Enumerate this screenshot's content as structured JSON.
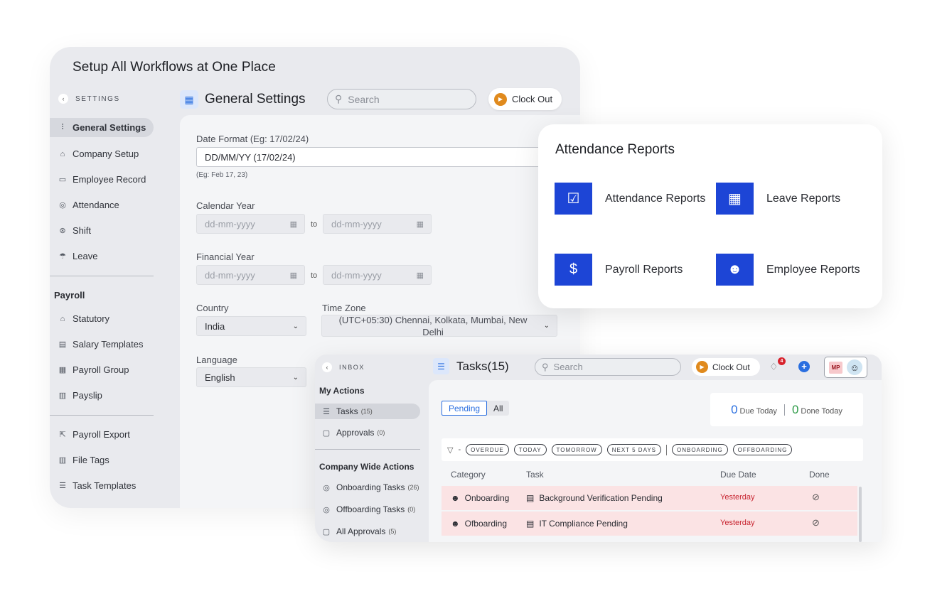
{
  "headline": "Setup All Workflows at One Place",
  "settings": {
    "section_label": "SETTINGS",
    "items": [
      {
        "label": "General Settings",
        "icon": "sliders-icon",
        "glyph": "⫶"
      },
      {
        "label": "Company Setup",
        "icon": "building-icon",
        "glyph": "⌂"
      },
      {
        "label": "Employee Record",
        "icon": "id-card-icon",
        "glyph": "▭"
      },
      {
        "label": "Attendance",
        "icon": "fingerprint-icon",
        "glyph": "◎"
      },
      {
        "label": "Shift",
        "icon": "shift-icon",
        "glyph": "⊛"
      },
      {
        "label": "Leave",
        "icon": "umbrella-icon",
        "glyph": "☂"
      }
    ],
    "payroll_section": "Payroll",
    "payroll_items": [
      {
        "label": "Statutory",
        "icon": "bank-icon",
        "glyph": "⌂"
      },
      {
        "label": "Salary Templates",
        "icon": "document-icon",
        "glyph": "▤"
      },
      {
        "label": "Payroll Group",
        "icon": "calendar-icon",
        "glyph": "▦"
      },
      {
        "label": "Payslip",
        "icon": "payslip-icon",
        "glyph": "▥"
      }
    ],
    "other_items": [
      {
        "label": "Payroll Export",
        "icon": "export-icon",
        "glyph": "⇱"
      },
      {
        "label": "File Tags",
        "icon": "file-tag-icon",
        "glyph": "▥"
      },
      {
        "label": "Task Templates",
        "icon": "checklist-icon",
        "glyph": "☰"
      }
    ]
  },
  "general": {
    "title": "General Settings",
    "search_placeholder": "Search",
    "clock_out": "Clock Out",
    "date_format_label": "Date Format (Eg: 17/02/24)",
    "date_format_value": "DD/MM/YY (17/02/24)",
    "date_format_hint": "(Eg: Feb 17, 23)",
    "calendar_year_label": "Calendar Year",
    "financial_year_label": "Financial Year",
    "date_placeholder": "dd-mm-yyyy",
    "to": "to",
    "country_label": "Country",
    "country_value": "India",
    "timezone_label": "Time Zone",
    "timezone_value": "(UTC+05:30) Chennai, Kolkata, Mumbai, New Delhi",
    "language_label": "Language",
    "language_value": "English"
  },
  "reports": {
    "title": "Attendance Reports",
    "items": [
      {
        "label": "Attendance Reports",
        "icon": "attendance-report-icon",
        "glyph": "☑"
      },
      {
        "label": "Leave Reports",
        "icon": "leave-calendar-icon",
        "glyph": "▦"
      },
      {
        "label": "Payroll Reports",
        "icon": "payroll-handshake-icon",
        "glyph": "$"
      },
      {
        "label": "Employee Reports",
        "icon": "employees-group-icon",
        "glyph": "☻"
      }
    ]
  },
  "tasks": {
    "inbox_label": "INBOX",
    "my_actions": "My Actions",
    "side_items": [
      {
        "label": "Tasks",
        "count": "(15)",
        "icon": "list-icon",
        "glyph": "☰"
      },
      {
        "label": "Approvals",
        "count": "(0)",
        "icon": "approval-icon",
        "glyph": "▢"
      }
    ],
    "company_actions": "Company Wide Actions",
    "company_items": [
      {
        "label": "Onboarding Tasks",
        "count": "(26)",
        "icon": "onboarding-icon",
        "glyph": "◎"
      },
      {
        "label": "Offboarding Tasks",
        "count": "(0)",
        "icon": "offboarding-icon",
        "glyph": "◎"
      },
      {
        "label": "All Approvals",
        "count": "(5)",
        "icon": "all-approvals-icon",
        "glyph": "▢"
      }
    ],
    "title": "Tasks(15)",
    "search_placeholder": "Search",
    "clock_out": "Clock Out",
    "notification_count": "4",
    "user_initials": "MP",
    "tabs": [
      "Pending",
      "All"
    ],
    "due_today_count": "0",
    "due_today_label": "Due Today",
    "done_today_count": "0",
    "done_today_label": "Done Today",
    "filter_dash": "-",
    "filters_a": [
      "OVERDUE",
      "TODAY",
      "TOMORROW",
      "NEXT 5 DAYS"
    ],
    "filters_b": [
      "ONBOARDING",
      "OFFBOARDING"
    ],
    "columns": [
      "Category",
      "Task",
      "Due Date",
      "Done"
    ],
    "rows": [
      {
        "category": "Onboarding",
        "task": "Background Verification Pending",
        "due": "Yesterday"
      },
      {
        "category": "Ofboarding",
        "task": "IT Compliance Pending",
        "due": "Yesterday"
      }
    ]
  },
  "colors": {
    "accent": "#2a6fe0",
    "clock_out": "#e08a1d",
    "report_icon_bg": "#1d45d6",
    "overdue_text": "#c82531",
    "overdue_row": "#fbe3e4"
  }
}
